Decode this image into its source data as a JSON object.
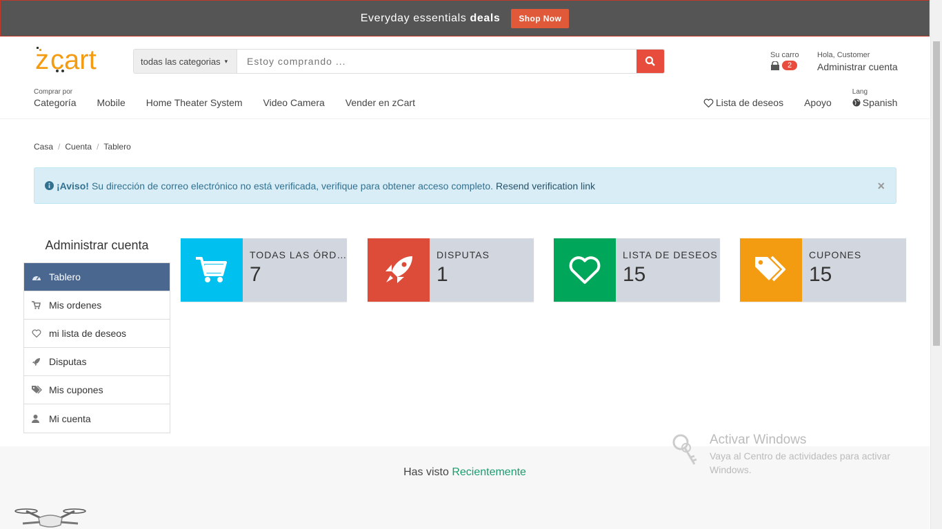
{
  "promo": {
    "text": "Everyday essentials",
    "bold": "deals",
    "button": "Shop Now"
  },
  "header": {
    "search": {
      "category": "todas las categorias",
      "placeholder": "Estoy comprando ..."
    },
    "cart": {
      "label": "Su carro",
      "count": "2"
    },
    "account": {
      "greeting": "Hola, Customer",
      "label": "Administrar cuenta"
    }
  },
  "nav": {
    "category_small": "Comprar por",
    "category": "Categoría",
    "items": [
      "Mobile",
      "Home Theater System",
      "Video Camera",
      "Vender en zCart"
    ],
    "wishlist": "Lista de deseos",
    "support": "Apoyo",
    "lang_small": "Lang",
    "lang": "Spanish"
  },
  "breadcrumb": [
    "Casa",
    "Cuenta",
    "Tablero"
  ],
  "alert": {
    "title": "¡Aviso!",
    "message": "Su dirección de correo electrónico no está verificada, verifique para obtener acceso completo.",
    "link": "Resend verification link",
    "close": "×"
  },
  "sidebar": {
    "title": "Administrar cuenta",
    "items": [
      {
        "label": "Tablero",
        "icon": "dashboard-icon",
        "active": true
      },
      {
        "label": "Mis ordenes",
        "icon": "cart-icon"
      },
      {
        "label": "mi lista de deseos",
        "icon": "heart-icon"
      },
      {
        "label": "Disputas",
        "icon": "rocket-icon"
      },
      {
        "label": "Mis cupones",
        "icon": "tags-icon"
      },
      {
        "label": "Mi cuenta",
        "icon": "user-icon"
      }
    ]
  },
  "stats": [
    {
      "label": "TODAS LAS ÓRDENES",
      "value": "7",
      "color": "#00c0ef",
      "icon": "cart-icon"
    },
    {
      "label": "DISPUTAS",
      "value": "1",
      "color": "#dd4b39",
      "icon": "rocket-icon"
    },
    {
      "label": "LISTA DE DESEOS",
      "value": "15",
      "color": "#00a65a",
      "icon": "heart-icon"
    },
    {
      "label": "CUPONES",
      "value": "15",
      "color": "#f39c12",
      "icon": "tags-icon"
    }
  ],
  "recent": {
    "prefix": "Has visto",
    "highlight": "Recientemente"
  },
  "watermark": {
    "title": "Activar Windows",
    "sub": "Vaya al Centro de actividades para activar Windows."
  },
  "colors": {
    "brand_orange": "#f39c12",
    "accent_red": "#e74c3c",
    "sidebar_active": "#4a6790"
  }
}
